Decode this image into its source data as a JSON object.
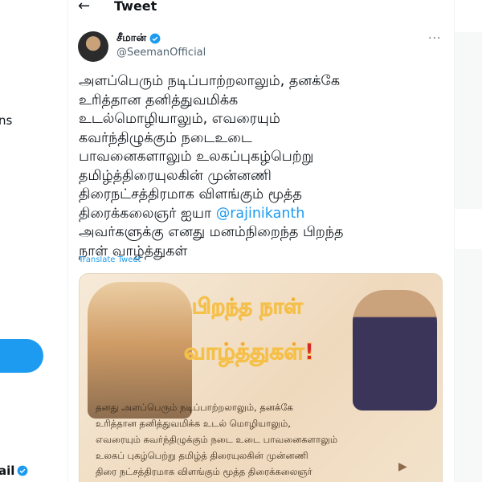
{
  "left_nav": {
    "fragment": "ns",
    "account_fragment": "ail"
  },
  "header": {
    "title": "Tweet"
  },
  "tweet": {
    "author_name": "சீமான்",
    "author_handle": "@SeemanOfficial",
    "text_before_mention": "அளப்பெரும் நடிப்பாற்றலாலும், தனக்கே\nஉரித்தான தனித்துவமிக்க\nஉடல்மொழியாலும், எவரையும்\nகவர்ந்திழுக்கும் நடைஉடை\nபாவனைகளாலும் உலகப்புகழ்பெற்று\nதமிழ்த்திரையுலகின் முன்னணி\nதிரைநட்சத்திரமாக விளங்கும் மூத்த\nதிரைக்கலைஞர் ஐயா ",
    "mention": "@rajinikanth",
    "text_after_mention": "\nஅவர்களுக்கு எனது மனம்நிறைந்த பிறந்த\nநாள் வாழ்த்துகள்",
    "translate_label": "Translate Tweet",
    "media": {
      "headline_1": "பிறந்த நாள்",
      "headline_2": "வாழ்த்துகள்!",
      "body_text": "தனது அளப்பெரும் நடிப்பாற்றலாலும், தனக்கே\nஉரித்தான தனித்துவமிக்க உடல் மொழியாலும்,\nஎவரையும் கவர்ந்திழுக்கும் நடை உடை பாவனைகளாலும்\nஉலகப் புகழ்பெற்று தமிழ்த் திரையுலகின் முன்னணி\nதிரை நட்சத்திரமாக விளங்கும் மூத்த திரைக்கலைஞர்"
    }
  },
  "colors": {
    "accent": "#1d9bf0",
    "text_primary": "#0f1419",
    "text_secondary": "#536471"
  }
}
